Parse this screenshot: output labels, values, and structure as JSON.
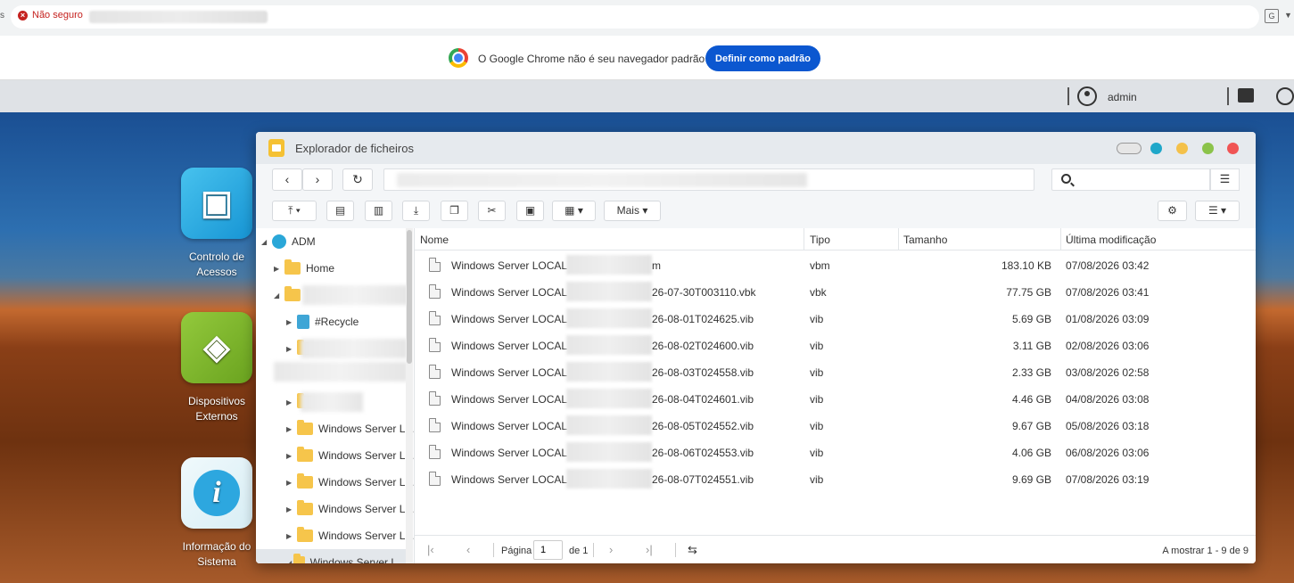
{
  "browser": {
    "security_label": "Não seguro",
    "infobar_text": "O Google Chrome não é seu navegador padrão",
    "infobar_button": "Definir como padrão"
  },
  "adm": {
    "user": "admin"
  },
  "desktop": {
    "apps": [
      {
        "label": "Controlo de Acessos"
      },
      {
        "label": "Dispositivos Externos"
      },
      {
        "label": "Informação do Sistema"
      }
    ]
  },
  "explorer": {
    "title": "Explorador de ficheiros",
    "toolbar": {
      "more_label": "Mais"
    },
    "tree": {
      "root": "ADM",
      "home": "Home",
      "recycle": "#Recycle",
      "folders": [
        "Windows Server L...",
        "Windows Server L...",
        "Windows Server L...",
        "Windows Server L...",
        "Windows Server L...",
        "Windows Server L..."
      ]
    },
    "columns": {
      "name": "Nome",
      "type": "Tipo",
      "size": "Tamanho",
      "modified": "Última modificação"
    },
    "files": [
      {
        "prefix": "Windows Server LOCAL -",
        "suffix": "m",
        "type": "vbm",
        "size": "183.10 KB",
        "modified": "07/08/2026 03:42"
      },
      {
        "prefix": "Windows Server LOCAL -",
        "suffix": "26-07-30T003110.vbk",
        "type": "vbk",
        "size": "77.75 GB",
        "modified": "07/08/2026 03:41"
      },
      {
        "prefix": "Windows Server LOCAL -",
        "suffix": "26-08-01T024625.vib",
        "type": "vib",
        "size": "5.69 GB",
        "modified": "01/08/2026 03:09"
      },
      {
        "prefix": "Windows Server LOCAL -",
        "suffix": "26-08-02T024600.vib",
        "type": "vib",
        "size": "3.11 GB",
        "modified": "02/08/2026 03:06"
      },
      {
        "prefix": "Windows Server LOCAL -",
        "suffix": "26-08-03T024558.vib",
        "type": "vib",
        "size": "2.33 GB",
        "modified": "03/08/2026 02:58"
      },
      {
        "prefix": "Windows Server LOCAL -",
        "suffix": "26-08-04T024601.vib",
        "type": "vib",
        "size": "4.46 GB",
        "modified": "04/08/2026 03:08"
      },
      {
        "prefix": "Windows Server LOCAL -",
        "suffix": "26-08-05T024552.vib",
        "type": "vib",
        "size": "9.67 GB",
        "modified": "05/08/2026 03:18"
      },
      {
        "prefix": "Windows Server LOCAL -",
        "suffix": "26-08-06T024553.vib",
        "type": "vib",
        "size": "4.06 GB",
        "modified": "06/08/2026 03:06"
      },
      {
        "prefix": "Windows Server LOCAL -",
        "suffix": "26-08-07T024551.vib",
        "type": "vib",
        "size": "9.69 GB",
        "modified": "07/08/2026 03:19"
      }
    ],
    "footer": {
      "page_label": "Página",
      "page_value": "1",
      "of_label": "de 1",
      "showing": "A mostrar 1 - 9 de 9"
    }
  },
  "colors": {
    "accent": "#0b57d0",
    "folder": "#f6c54b",
    "win_close": "#f05454",
    "win_max": "#8bc34a",
    "win_min": "#f4c14a",
    "win_extra": "#1fa7c9"
  }
}
